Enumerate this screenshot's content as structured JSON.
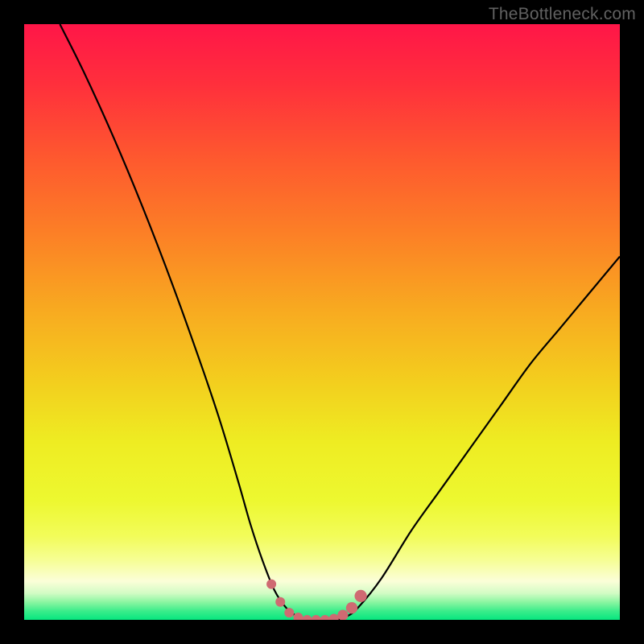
{
  "watermark": "TheBottleneck.com",
  "colors": {
    "page_bg": "#000000",
    "curve_stroke": "#000000",
    "marker_fill": "#cf6a72",
    "gradient_stops": [
      {
        "offset": 0.0,
        "color": "#ff1648"
      },
      {
        "offset": 0.1,
        "color": "#ff2f3c"
      },
      {
        "offset": 0.22,
        "color": "#fe572f"
      },
      {
        "offset": 0.35,
        "color": "#fc7f26"
      },
      {
        "offset": 0.48,
        "color": "#f8aa20"
      },
      {
        "offset": 0.6,
        "color": "#f3ce1e"
      },
      {
        "offset": 0.7,
        "color": "#eeec22"
      },
      {
        "offset": 0.8,
        "color": "#edf830"
      },
      {
        "offset": 0.86,
        "color": "#f2fc5a"
      },
      {
        "offset": 0.9,
        "color": "#f6fe95"
      },
      {
        "offset": 0.935,
        "color": "#fbfed8"
      },
      {
        "offset": 0.955,
        "color": "#d3fcc5"
      },
      {
        "offset": 0.97,
        "color": "#8cf6a2"
      },
      {
        "offset": 0.985,
        "color": "#3ced8b"
      },
      {
        "offset": 1.0,
        "color": "#07e67f"
      }
    ]
  },
  "chart_data": {
    "type": "line",
    "title": "",
    "xlabel": "",
    "ylabel": "",
    "xlim": [
      0,
      100
    ],
    "ylim": [
      0,
      100
    ],
    "grid": false,
    "series": [
      {
        "name": "bottleneck-curve",
        "x": [
          6,
          10,
          15,
          20,
          25,
          30,
          33,
          36,
          38,
          40,
          42,
          44,
          46,
          48,
          50,
          52,
          54,
          56,
          60,
          65,
          70,
          75,
          80,
          85,
          90,
          95,
          100
        ],
        "y": [
          100,
          92,
          81,
          69,
          56,
          42,
          33,
          23,
          16,
          10,
          5,
          2,
          0.5,
          0,
          0,
          0,
          0.5,
          2,
          7,
          15,
          22,
          29,
          36,
          43,
          49,
          55,
          61
        ]
      }
    ],
    "markers": {
      "name": "flat-bottom-points",
      "x": [
        41.5,
        43,
        44.5,
        46,
        47.5,
        49,
        50.5,
        52,
        53.5,
        55,
        56.5
      ],
      "y": [
        6,
        3,
        1.2,
        0.4,
        0,
        0,
        0,
        0.2,
        0.8,
        2,
        4
      ],
      "r": [
        6,
        6,
        6,
        6,
        6,
        6,
        6,
        6,
        6.6,
        7.2,
        7.6
      ]
    }
  }
}
